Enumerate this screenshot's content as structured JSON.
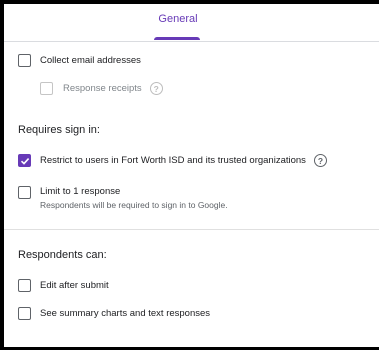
{
  "tabs": {
    "general": "General"
  },
  "collect_email": {
    "label": "Collect email addresses",
    "checked": false
  },
  "response_receipts": {
    "label": "Response receipts",
    "checked": false,
    "disabled": true
  },
  "requires_sign_in": {
    "heading": "Requires sign in:",
    "restrict": {
      "label": "Restrict to users in Fort Worth ISD and its trusted organizations",
      "checked": true
    },
    "limit": {
      "label": "Limit to 1 response",
      "sublabel": "Respondents will be required to sign in to Google.",
      "checked": false
    }
  },
  "respondents_can": {
    "heading": "Respondents can:",
    "edit": {
      "label": "Edit after submit",
      "checked": false
    },
    "summary": {
      "label": "See summary charts and text responses",
      "checked": false
    }
  },
  "colors": {
    "accent": "#673ab7"
  }
}
